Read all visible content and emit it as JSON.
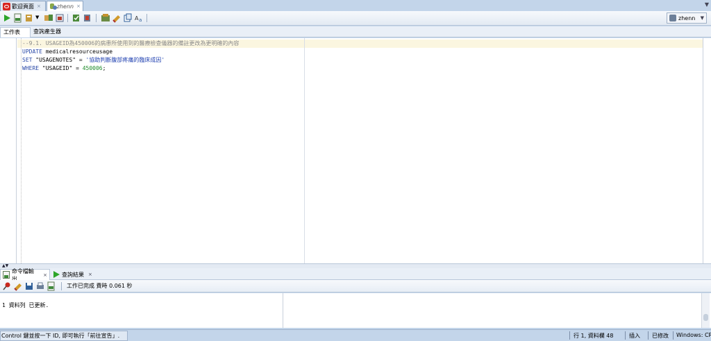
{
  "doc_tabs": [
    {
      "label": "歡迎頁面",
      "close": "×"
    },
    {
      "label": "zhenn",
      "close": "×"
    }
  ],
  "toolbar": {
    "connection": "zhenn"
  },
  "sub_tabs": [
    "工作表",
    "查詢產生器"
  ],
  "editor": {
    "lines": [
      {
        "segments": [
          {
            "t": "--9.1. USAGEID為450006的病患所使用到的醫療檢查儀器的備註更改為更明確的內容",
            "c": "cm"
          }
        ]
      },
      {
        "segments": [
          {
            "t": "UPDATE",
            "c": "kw"
          },
          {
            "t": " medicalresourceusage",
            "c": ""
          }
        ]
      },
      {
        "segments": [
          {
            "t": "SET",
            "c": "kw"
          },
          {
            "t": " \"USAGENOTES\" = ",
            "c": ""
          },
          {
            "t": "'協助判斷腹部疼痛的臨床成因'",
            "c": "str"
          }
        ]
      },
      {
        "segments": [
          {
            "t": "WHERE",
            "c": "kw"
          },
          {
            "t": " \"USAGEID\" = ",
            "c": ""
          },
          {
            "t": "450006",
            "c": "num"
          },
          {
            "t": ";",
            "c": ""
          }
        ]
      }
    ]
  },
  "output_tabs": [
    {
      "label": "命令檔輸出",
      "close": "×"
    },
    {
      "label": "查詢結果",
      "close": "×"
    }
  ],
  "output": {
    "task_status": "工作已完成 費時 0.061 秒",
    "message": "1 資料列 已更新."
  },
  "status_bar": {
    "message": "Control 鍵並按一下 ID, 即可執行「前往宣告」.",
    "position": "行 1, 資料欄 48",
    "insert_mode": "插入",
    "modified": "已修改",
    "line_ending": "Windows: CR"
  }
}
